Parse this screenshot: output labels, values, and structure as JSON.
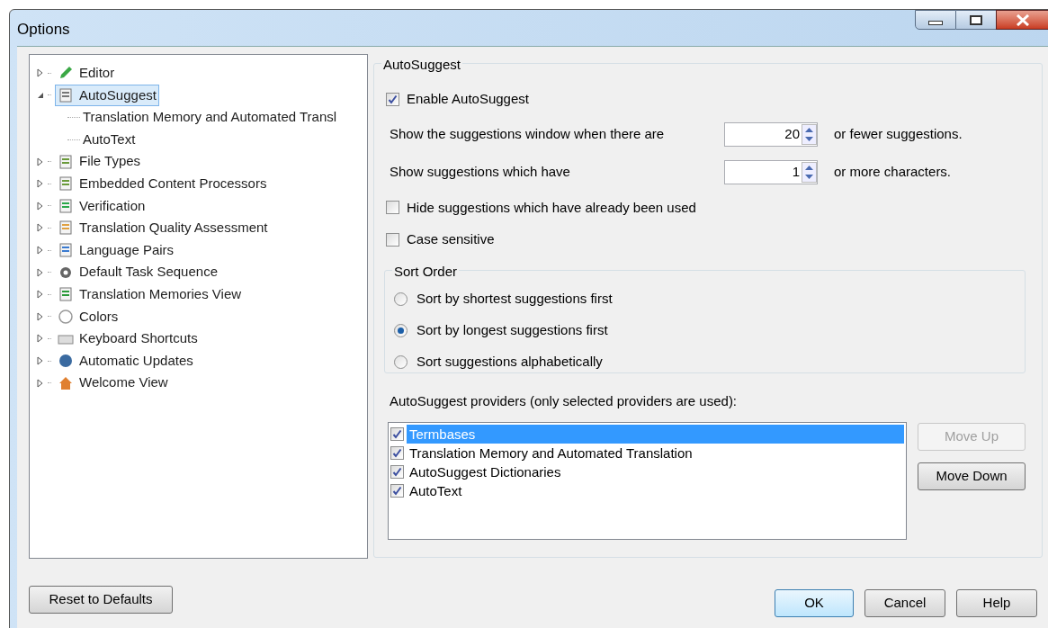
{
  "window": {
    "title": "Options"
  },
  "tree": [
    {
      "label": "Editor",
      "expanded": false,
      "selected": false
    },
    {
      "label": "AutoSuggest",
      "expanded": true,
      "selected": true,
      "children": [
        {
          "label": "Translation Memory and Automated Transl",
          "selected": false
        },
        {
          "label": "AutoText",
          "selected": false
        }
      ]
    },
    {
      "label": "File Types",
      "expanded": false,
      "selected": false
    },
    {
      "label": "Embedded Content Processors",
      "expanded": false,
      "selected": false
    },
    {
      "label": "Verification",
      "expanded": false,
      "selected": false
    },
    {
      "label": "Translation Quality Assessment",
      "expanded": false,
      "selected": false
    },
    {
      "label": "Language Pairs",
      "expanded": false,
      "selected": false
    },
    {
      "label": "Default Task Sequence",
      "expanded": false,
      "selected": false
    },
    {
      "label": "Translation Memories View",
      "expanded": false,
      "selected": false
    },
    {
      "label": "Colors",
      "expanded": false,
      "selected": false
    },
    {
      "label": "Keyboard Shortcuts",
      "expanded": false,
      "selected": false
    },
    {
      "label": "Automatic Updates",
      "expanded": false,
      "selected": false
    },
    {
      "label": "Welcome View",
      "expanded": false,
      "selected": false
    }
  ],
  "panel": {
    "title": "AutoSuggest",
    "enable": {
      "label": "Enable AutoSuggest",
      "checked": true
    },
    "spins": [
      {
        "label": "Show the suggestions window when there are",
        "value": "20",
        "suffix": "or fewer suggestions."
      },
      {
        "label": "Show suggestions which have",
        "value": "1",
        "suffix": "or more characters."
      }
    ],
    "options": [
      {
        "label": "Hide suggestions which have already been used",
        "checked": false
      },
      {
        "label": "Case sensitive",
        "checked": false
      }
    ],
    "sort_order": {
      "title": "Sort Order",
      "choices": [
        {
          "label": "Sort by shortest suggestions first",
          "selected": false
        },
        {
          "label": "Sort by longest suggestions first",
          "selected": true
        },
        {
          "label": "Sort suggestions alphabetically",
          "selected": false
        }
      ]
    },
    "providers_label": "AutoSuggest providers (only selected providers are used):",
    "providers": [
      {
        "label": "Termbases",
        "checked": true,
        "selected": true
      },
      {
        "label": "Translation Memory and Automated Translation",
        "checked": true,
        "selected": false
      },
      {
        "label": "AutoSuggest Dictionaries",
        "checked": true,
        "selected": false
      },
      {
        "label": "AutoText",
        "checked": true,
        "selected": false
      }
    ],
    "move_buttons": [
      {
        "label": "Move Up",
        "disabled": true
      },
      {
        "label": "Move Down",
        "disabled": false
      }
    ]
  },
  "reset_button": "Reset to Defaults",
  "buttons": [
    {
      "label": "OK",
      "default": true
    },
    {
      "label": "Cancel",
      "default": false
    },
    {
      "label": "Help",
      "default": false
    }
  ]
}
